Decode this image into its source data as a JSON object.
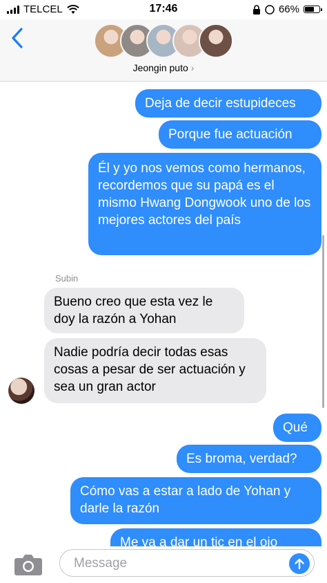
{
  "status_bar": {
    "carrier": "TELCEL",
    "time": "17:46",
    "battery": "66%",
    "battery_level": 0.66
  },
  "header": {
    "group_name": "Jeongin puto",
    "chevron": "›"
  },
  "avatar_colors": [
    "#c9a27e",
    "#8f8a85",
    "#a7b6c4",
    "#d8c2b8",
    "#6d5146"
  ],
  "messages": [
    {
      "dir": "out",
      "text": "Deja de decir estupideces"
    },
    {
      "dir": "out",
      "text": "Porque fue actuación"
    },
    {
      "dir": "out",
      "text": "Él y yo nos vemos como hermanos, recordemos que su papá es el mismo Hwang Dongwook uno de los mejores actores del país"
    },
    {
      "dir": "in",
      "sender": "Subin",
      "text": "Bueno creo que esta vez le doy la razón a Yohan"
    },
    {
      "dir": "in",
      "text": "Nadie podría decir todas esas cosas a pesar de ser actuación y sea un gran actor"
    },
    {
      "dir": "out",
      "text": "Qué"
    },
    {
      "dir": "out",
      "text": "Es broma, verdad?"
    },
    {
      "dir": "out",
      "text": "Cómo vas a estar a lado de Yohan y darle la razón"
    },
    {
      "dir": "out",
      "text": "Me va a dar un tic en el ojo"
    }
  ],
  "compose": {
    "placeholder": "Message"
  },
  "colors": {
    "outgoing": "#2f8dfc",
    "incoming": "#e9e9eb",
    "accent": "#1a7cf5"
  },
  "icons": [
    "signal-icon",
    "wifi-icon",
    "lock-rotation-icon",
    "moon-icon",
    "battery-icon",
    "back-chevron-icon",
    "camera-icon",
    "send-arrow-icon"
  ]
}
